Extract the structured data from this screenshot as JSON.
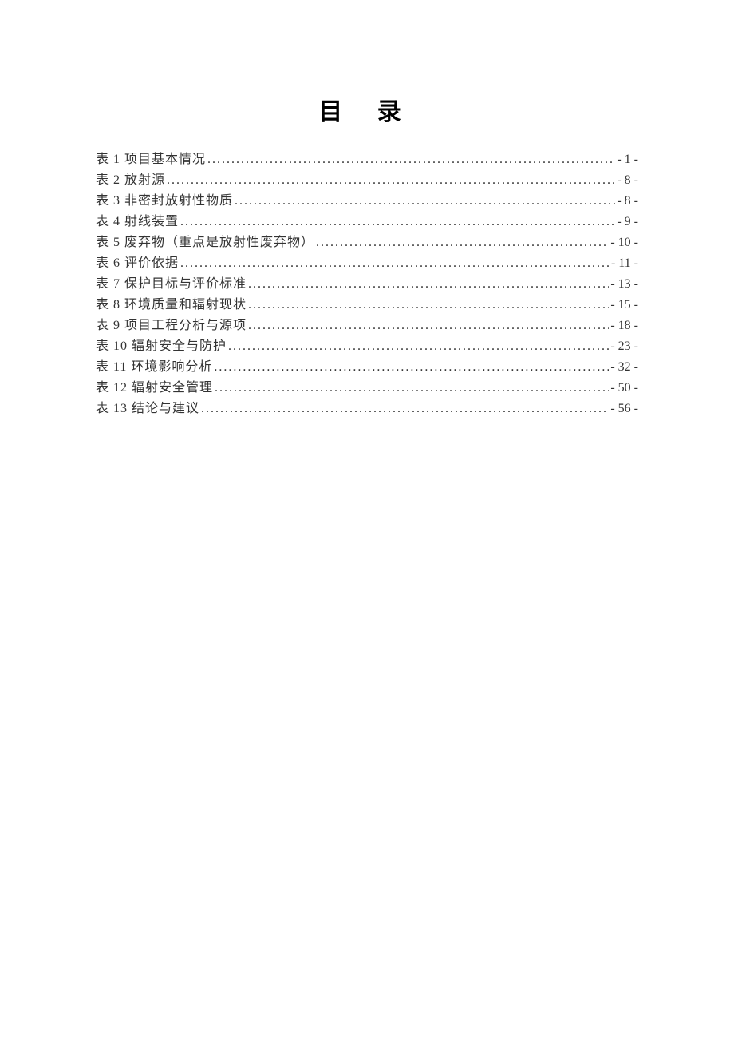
{
  "title": "目 录",
  "toc": {
    "entries": [
      {
        "label": "表 1  项目基本情况",
        "page": "- 1 -"
      },
      {
        "label": "表 2 放射源",
        "page": "- 8 -"
      },
      {
        "label": "表 3 非密封放射性物质",
        "page": "- 8 -"
      },
      {
        "label": "表 4 射线装置",
        "page": "- 9 -"
      },
      {
        "label": "表 5 废弃物（重点是放射性废弃物）",
        "page": "- 10 -"
      },
      {
        "label": "表 6 评价依据",
        "page": "- 11 -"
      },
      {
        "label": "表 7 保护目标与评价标准",
        "page": "- 13 -"
      },
      {
        "label": "表 8 环境质量和辐射现状",
        "page": "- 15 -"
      },
      {
        "label": "表 9 项目工程分析与源项",
        "page": "- 18 -"
      },
      {
        "label": "表 10 辐射安全与防护",
        "page": "- 23 -"
      },
      {
        "label": "表 11 环境影响分析",
        "page": "- 32 -"
      },
      {
        "label": "表 12 辐射安全管理",
        "page": "- 50 -"
      },
      {
        "label": "表 13 结论与建议",
        "page": "- 56 -"
      }
    ]
  }
}
